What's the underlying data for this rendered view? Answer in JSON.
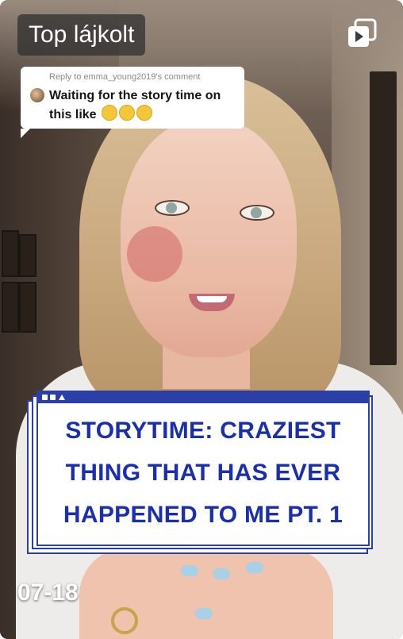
{
  "header": {
    "label": "Top lájkolt",
    "corner_icon": "repost-multi-icon"
  },
  "reply": {
    "header": "Reply to emma_young2019's comment",
    "text": "Waiting for the story time on this like",
    "emojis": [
      "flushed-face-icon",
      "pleading-face-icon",
      "relieved-face-icon"
    ]
  },
  "overlay": {
    "lines": [
      "STORYTIME: CRAZIEST",
      "THING THAT HAS EVER",
      "HAPPENED TO ME PT. 1"
    ]
  },
  "footer": {
    "date": "07-18"
  },
  "colors": {
    "overlay_text": "#1a2fae",
    "overlay_border": "#2a3fa8",
    "label_bg": "#2d2d2d"
  }
}
